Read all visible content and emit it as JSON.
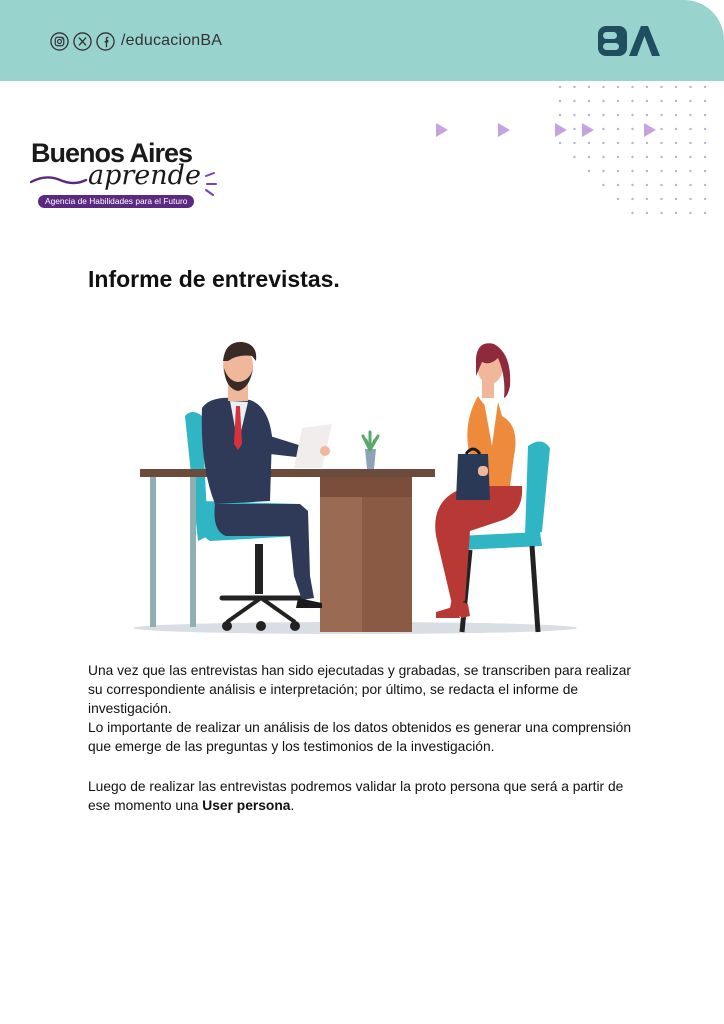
{
  "header": {
    "social_icons": [
      "instagram-icon",
      "x-icon",
      "facebook-icon"
    ],
    "handle": "/educacionBA",
    "logo_text": "BA",
    "background_color": "#98d3ce",
    "arrow_color": "#c5a3de"
  },
  "brand": {
    "title": "Buenos Aires",
    "script": "aprende",
    "tagline": "Agencia de Habilidades para el Futuro",
    "accent_color": "#5a2a82"
  },
  "document": {
    "title": "Informe de entrevistas.",
    "paragraph1": "Una vez que las entrevistas han sido ejecutadas y grabadas, se transcriben para realizar su correspondiente análisis e interpretación; por último, se redacta el informe de investigación.",
    "paragraph2": "Lo importante de realizar un análisis de los datos obtenidos es generar una comprensión que emerge de las preguntas y los testimonios de la investigación.",
    "paragraph3_start": "Luego de realizar las entrevistas podremos validar la proto persona que será a partir de ese momento una ",
    "paragraph3_bold": "User persona",
    "paragraph3_end": "."
  }
}
